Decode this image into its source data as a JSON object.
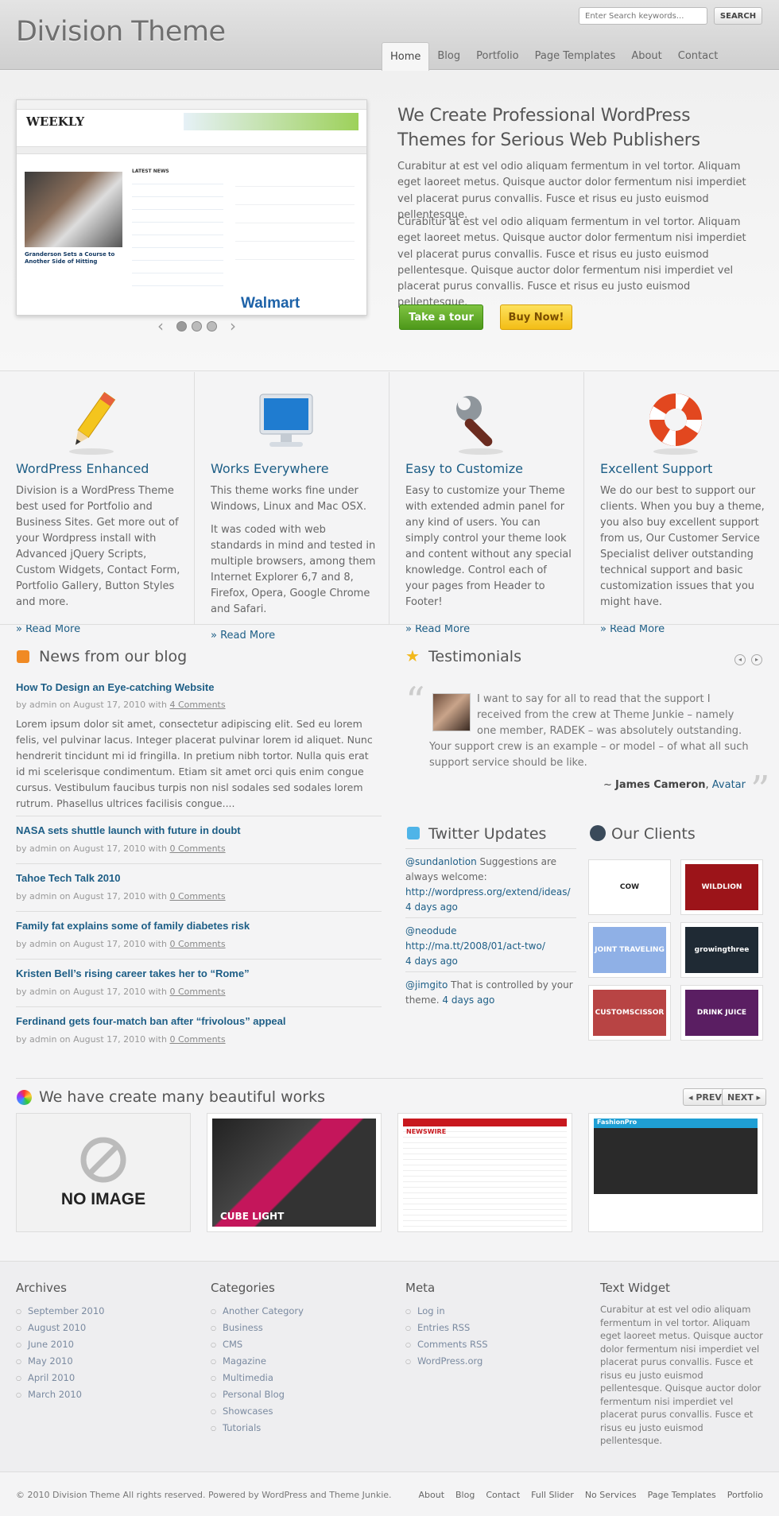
{
  "header": {
    "logo": "Division Theme",
    "search_placeholder": "Enter Search keywords...",
    "search_button": "SEARCH",
    "nav": [
      "Home",
      "Blog",
      "Portfolio",
      "Page Templates",
      "About",
      "Contact"
    ]
  },
  "hero": {
    "title": "We Create Professional WordPress Themes for Serious Web Publishers",
    "p1": "Curabitur at est vel odio aliquam fermentum in vel tortor. Aliquam eget laoreet metus. Quisque auctor dolor fermentum nisi imperdiet vel placerat purus convallis. Fusce et risus eu justo euismod pellentesque.",
    "p2": "Curabitur at est vel odio aliquam fermentum in vel tortor. Aliquam eget laoreet metus. Quisque auctor dolor fermentum nisi imperdiet vel placerat purus convallis. Fusce et risus eu justo euismod pellentesque. Quisque auctor dolor fermentum nisi imperdiet vel placerat purus convallis. Fusce et risus eu justo euismod pellentesque.",
    "btn_tour": "Take a tour",
    "btn_buy": "Buy Now!",
    "shot": {
      "masthead": "WEEKLY",
      "latest": "LATEST NEWS",
      "story": "Granderson Sets a Course to Another Side of Hitting",
      "ad": "Walmart"
    }
  },
  "features": [
    {
      "title": "WordPress Enhanced",
      "icon": "pencil-icon",
      "paras": [
        "Division is a WordPress Theme best used for Portfolio and Business Sites. Get more out of your Wordpress install with Advanced jQuery Scripts, Custom Widgets, Contact Form, Portfolio Gallery, Button Styles and more."
      ],
      "more": "» Read More"
    },
    {
      "title": "Works Everywhere",
      "icon": "monitor-icon",
      "paras": [
        "This theme works fine under Windows, Linux and Mac OSX.",
        "It was coded with web standards in mind and tested in multiple browsers, among them Internet Explorer 6,7 and 8, Firefox, Opera, Google Chrome and Safari."
      ],
      "more": "» Read More"
    },
    {
      "title": "Easy to Customize",
      "icon": "wrench-icon",
      "paras": [
        "Easy to customize your Theme with extended admin panel for any kind of users. You can simply control your theme look and content without any special knowledge. Control each of your pages from Header to Footer!"
      ],
      "more": "» Read More"
    },
    {
      "title": "Excellent Support",
      "icon": "lifebuoy-icon",
      "paras": [
        "We do our best to support our clients. When you buy a theme, you also buy excellent support from us, Our Customer Service Specialist deliver outstanding technical support and basic customization issues that you might have."
      ],
      "more": "» Read More"
    }
  ],
  "blog": {
    "heading": "News from our blog",
    "posts": [
      {
        "title": "How To Design an Eye-catching Website",
        "meta_pre": "by admin on August 17, 2010 with",
        "comments": "4 Comments"
      },
      {
        "title": "NASA sets shuttle launch with future in doubt",
        "meta_pre": "by admin on August 17, 2010 with",
        "comments": "0 Comments"
      },
      {
        "title": "Tahoe Tech Talk 2010",
        "meta_pre": "by admin on August 17, 2010 with",
        "comments": "0 Comments"
      },
      {
        "title": "Family fat explains some of family diabetes risk",
        "meta_pre": "by admin on August 17, 2010 with",
        "comments": "0 Comments"
      },
      {
        "title": "Kristen Bell’s rising career takes her to “Rome”",
        "meta_pre": "by admin on August 17, 2010 with",
        "comments": "0 Comments"
      },
      {
        "title": "Ferdinand gets four-match ban after “frivolous” appeal",
        "meta_pre": "by admin on August 17, 2010 with",
        "comments": "0 Comments"
      }
    ],
    "excerpt": "Lorem ipsum dolor sit amet, consectetur adipiscing elit. Sed eu lorem felis, vel pulvinar lacus. Integer placerat pulvinar lorem id aliquet. Nunc hendrerit tincidunt mi id fringilla. In pretium nibh tortor. Nulla quis erat id mi scelerisque condimentum. Etiam sit amet orci quis enim congue cursus. Vestibulum faucibus turpis non nisl sodales sed sodales lorem rutrum. Phasellus ultrices facilisis congue...."
  },
  "testimonials": {
    "heading": "Testimonials",
    "quote": "I want to say for all to read that the support I received from the crew at Theme Junkie – namely one member, RADEK – was absolutely outstanding. Your support crew is an example – or model – of what all such support service should be like.",
    "author_prefix": "~",
    "author": "James Cameron",
    "author_sep": ",",
    "author_site": "Avatar"
  },
  "twitter": {
    "heading": "Twitter Updates",
    "items": [
      {
        "user": "@sundanlotion",
        "text": " Suggestions are always welcome: ",
        "link": "http://wordpress.org/extend/ideas/",
        "time": "4 days ago"
      },
      {
        "user": "@neodude",
        "text": " ",
        "link": "http://ma.tt/2008/01/act-two/",
        "time": "4 days ago"
      },
      {
        "user": "@jimgito",
        "text": " That is controlled by your theme. ",
        "link": "",
        "time": "4 days ago"
      }
    ]
  },
  "clients": {
    "heading": "Our Clients",
    "logos": [
      "COW",
      "WILDLION",
      "JOINT TRAVELING",
      "growingthree",
      "CUSTOMSCISSOR",
      "DRINK JUICE"
    ]
  },
  "works": {
    "heading": "We have create many beautiful works",
    "prev": "PREV",
    "next": "NEXT",
    "no_image": "NO IMAGE",
    "labels": [
      "CUBE LIGHT",
      "NEWSWIRE",
      "FashionPro"
    ]
  },
  "footer_widgets": {
    "archives": {
      "title": "Archives",
      "items": [
        "September 2010",
        "August 2010",
        "June 2010",
        "May 2010",
        "April 2010",
        "March 2010"
      ]
    },
    "categories": {
      "title": "Categories",
      "items": [
        "Another Category",
        "Business",
        "CMS",
        "Magazine",
        "Multimedia",
        "Personal Blog",
        "Showcases",
        "Tutorials"
      ]
    },
    "meta": {
      "title": "Meta",
      "items": [
        "Log in",
        "Entries RSS",
        "Comments RSS",
        "WordPress.org"
      ]
    },
    "text": {
      "title": "Text Widget",
      "body": "Curabitur at est vel odio aliquam fermentum in vel tortor. Aliquam eget laoreet metus. Quisque auctor dolor fermentum nisi imperdiet vel placerat purus convallis. Fusce et risus eu justo euismod pellentesque. Quisque auctor dolor fermentum nisi imperdiet vel placerat purus convallis. Fusce et risus eu justo euismod pellentesque."
    }
  },
  "footer": {
    "copyright": "© 2010 Division Theme All rights reserved. Powered by WordPress and Theme Junkie.",
    "nav": [
      "About",
      "Blog",
      "Contact",
      "Full Slider",
      "No Services",
      "Page Templates",
      "Portfolio"
    ]
  }
}
